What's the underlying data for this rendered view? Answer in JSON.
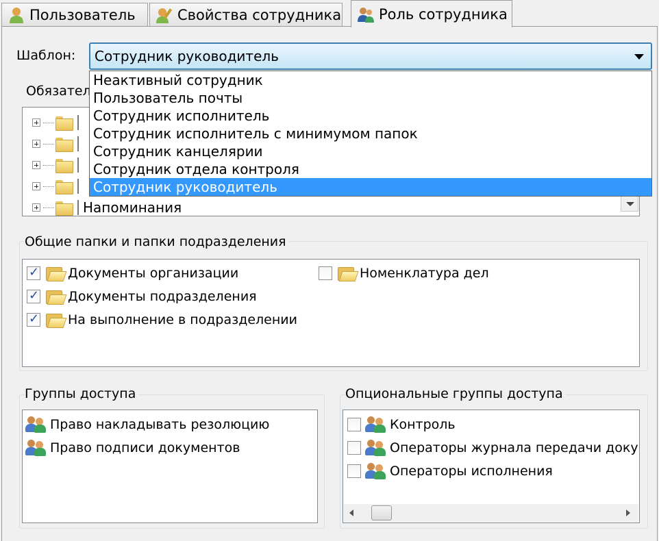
{
  "tabs": [
    {
      "label": "Пользователь",
      "icon": "user-icon"
    },
    {
      "label": "Свойства сотрудника",
      "icon": "user-properties-icon"
    },
    {
      "label": "Роль сотрудника",
      "icon": "user-role-icon"
    }
  ],
  "template": {
    "label": "Шаблон:",
    "selected": "Сотрудник руководитель",
    "options": [
      "Неактивный сотрудник",
      "Пользователь почты",
      "Сотрудник исполнитель",
      "Сотрудник исполнитель с минимумом папок",
      "Сотрудник канцелярии",
      "Сотрудник отдела контроля",
      "Сотрудник руководитель"
    ]
  },
  "required_section": {
    "label_partial": "Обязател",
    "last_visible_item": "Напоминания"
  },
  "shared_folders": {
    "title": "Общие папки и папки подразделения",
    "items": [
      {
        "label": "Документы организации",
        "checked": true
      },
      {
        "label": "Документы подразделения",
        "checked": true
      },
      {
        "label": "На выполнение в подразделении",
        "checked": true
      },
      {
        "label": "Номенклатура дел",
        "checked": false
      }
    ]
  },
  "access_groups": {
    "title": "Группы доступа",
    "items": [
      "Право накладывать резолюцию",
      "Право подписи документов"
    ]
  },
  "optional_groups": {
    "title": "Опциональные группы доступа",
    "items": [
      {
        "label": "Контроль",
        "checked": false
      },
      {
        "label": "Операторы журнала передачи доку",
        "checked": false
      },
      {
        "label": "Операторы исполнения",
        "checked": false
      }
    ]
  }
}
